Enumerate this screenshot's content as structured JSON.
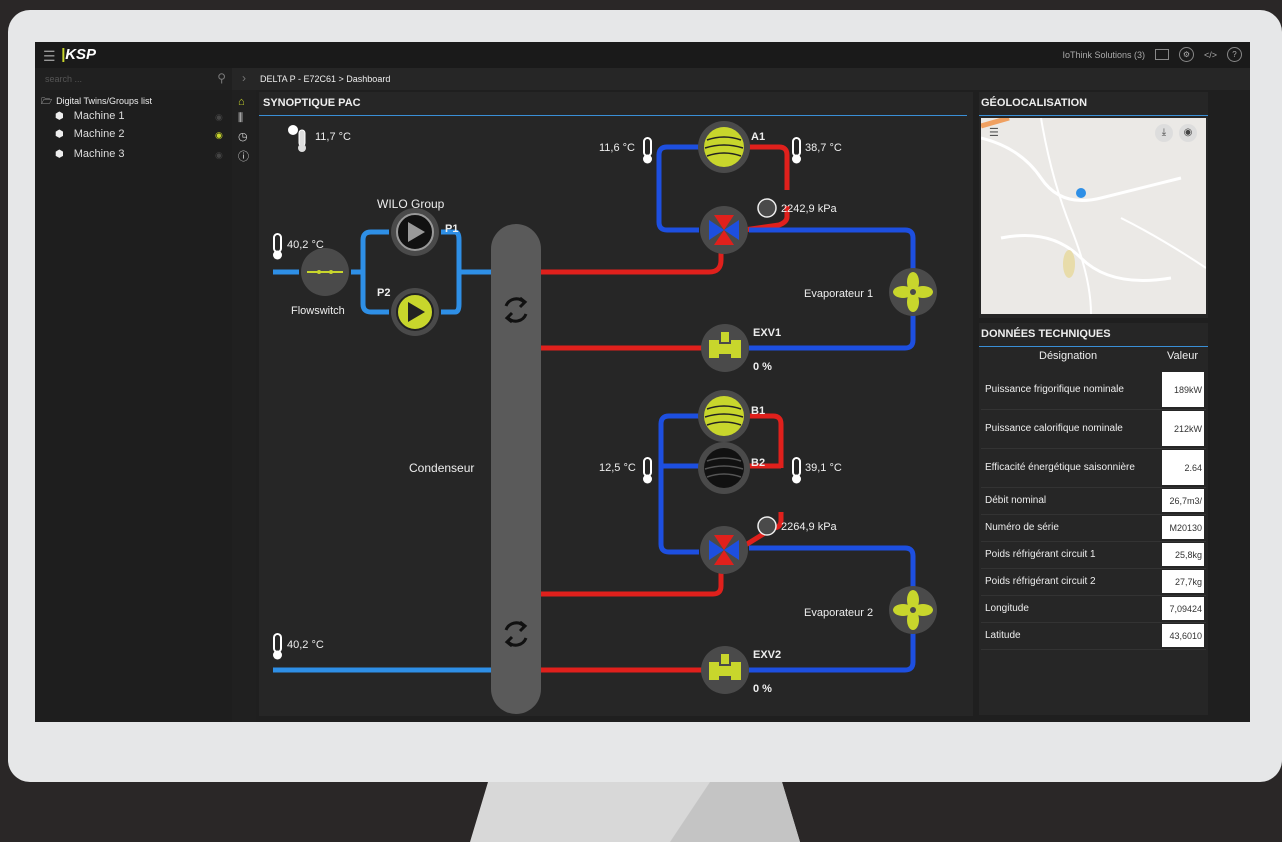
{
  "app": {
    "logo": "KSP",
    "company": "IoThink Solutions (3)"
  },
  "search": {
    "placeholder": "search ..."
  },
  "breadcrumb": "DELTA P - E72C61 > Dashboard",
  "tree": {
    "root": "Digital Twins/Groups list",
    "items": [
      "Machine 1",
      "Machine 2",
      "Machine 3"
    ]
  },
  "synoptic": {
    "title": "SYNOPTIQUE PAC",
    "outdoor_temp": "11,7 °C",
    "pump_group": "WILO Group",
    "pump1": "P1",
    "pump2": "P2",
    "flowswitch": "Flowswitch",
    "inlet_temp_top": "40,2 °C",
    "inlet_temp_bottom": "40,2 °C",
    "condenser": "Condenseur",
    "circuit1": {
      "compressor": "A1",
      "temp_left": "11,6 °C",
      "temp_right": "38,7 °C",
      "pressure": "2242,9 kPa",
      "evaporator": "Evaporateur 1",
      "valve": "EXV1",
      "valve_pct": "0 %"
    },
    "circuit2": {
      "compressor1": "B1",
      "compressor2": "B2",
      "temp_left": "12,5 °C",
      "temp_right": "39,1 °C",
      "pressure": "2264,9 kPa",
      "evaporator": "Evaporateur 2",
      "valve": "EXV2",
      "valve_pct": "0 %"
    }
  },
  "geo": {
    "title": "GÉOLOCALISATION"
  },
  "tech": {
    "title": "DONNÉES TECHNIQUES",
    "col_designation": "Désignation",
    "col_value": "Valeur",
    "rows": [
      {
        "label": "Puissance frigorifique nominale",
        "value": "189kW"
      },
      {
        "label": "Puissance calorifique nominale",
        "value": "212kW"
      },
      {
        "label": "Efficacité énergétique saisonnière",
        "value": "2.64"
      },
      {
        "label": "Débit nominal",
        "value": "26,7m3/"
      },
      {
        "label": "Numéro de série",
        "value": "M20130"
      },
      {
        "label": "Poids réfrigérant circuit 1",
        "value": "25,8kg"
      },
      {
        "label": "Poids réfrigérant circuit 2",
        "value": "27,7kg"
      },
      {
        "label": "Longitude",
        "value": "7,09424"
      },
      {
        "label": "Latitude",
        "value": "43,6010"
      }
    ]
  },
  "colors": {
    "hot": "#e0201c",
    "cold": "#1d4fe0",
    "water": "#2e8fe6",
    "accent": "#c8d62c",
    "panel": "#262626"
  }
}
